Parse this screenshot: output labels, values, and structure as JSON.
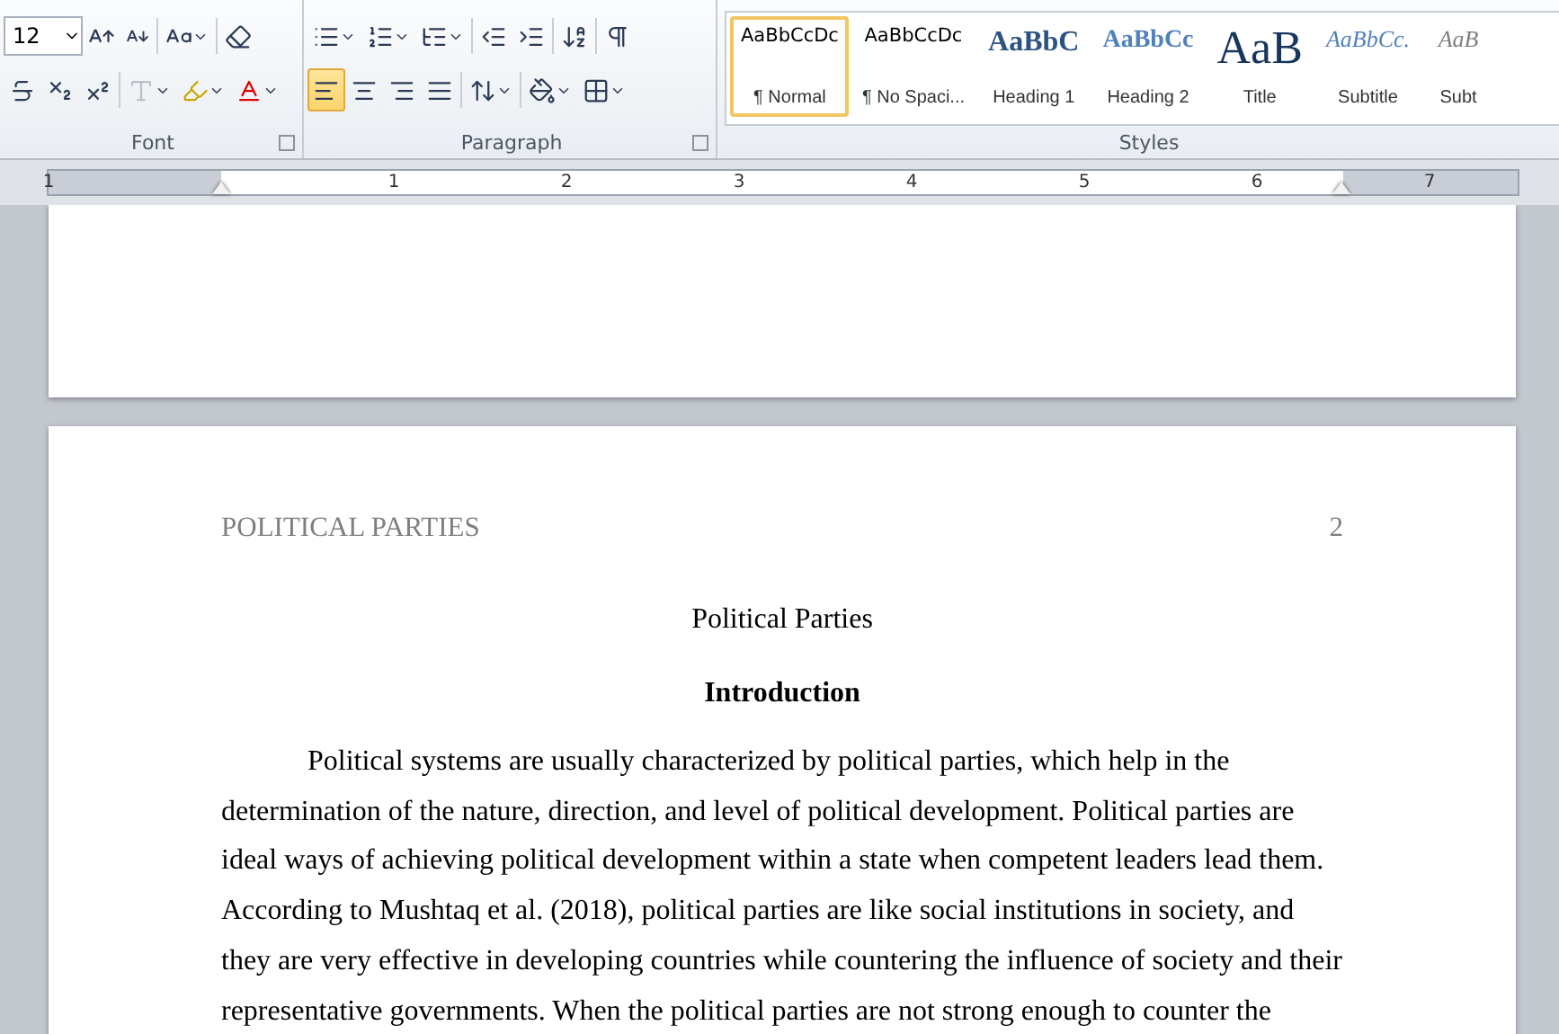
{
  "ribbon": {
    "font_group": {
      "label": "Font",
      "font_size": "12"
    },
    "paragraph_group": {
      "label": "Paragraph",
      "alignments": [
        {
          "kind": "left",
          "selected": true
        },
        {
          "kind": "center",
          "selected": false
        },
        {
          "kind": "right",
          "selected": false
        },
        {
          "kind": "justify",
          "selected": false
        }
      ]
    },
    "styles_group": {
      "label": "Styles",
      "styles": [
        {
          "kind": "normal",
          "preview": "AaBbCcDc",
          "label": "¶ Normal",
          "selected": true
        },
        {
          "kind": "nospacing",
          "preview": "AaBbCcDc",
          "label": "¶ No Spaci...",
          "selected": false
        },
        {
          "kind": "heading1",
          "preview": "AaBbC",
          "label": "Heading 1",
          "selected": false
        },
        {
          "kind": "heading2",
          "preview": "AaBbCc",
          "label": "Heading 2",
          "selected": false
        },
        {
          "kind": "title",
          "preview": "AaB",
          "label": "Title",
          "selected": false
        },
        {
          "kind": "subtitle",
          "preview": "AaBbCc.",
          "label": "Subtitle",
          "selected": false
        },
        {
          "kind": "subtle",
          "preview": "AaB",
          "label": "Subt",
          "selected": false
        }
      ]
    }
  },
  "ruler": {
    "labels": [
      "1",
      "1",
      "2",
      "3",
      "4",
      "5",
      "6",
      "7"
    ]
  },
  "document": {
    "header": {
      "title": "POLITICAL PARTIES",
      "page_number": "2"
    },
    "title": "Political Parties",
    "heading": "Introduction",
    "paragraph": "Political systems are usually characterized by political parties, which help in the determination of the nature, direction, and level of political development. Political parties are ideal ways of achieving political development within a state when competent leaders lead them. According to Mushtaq et al. (2018), political parties are like social institutions in society, and they are very effective in developing countries while countering the influence of society and their representative governments. When the political parties are not strong enough to counter the"
  }
}
